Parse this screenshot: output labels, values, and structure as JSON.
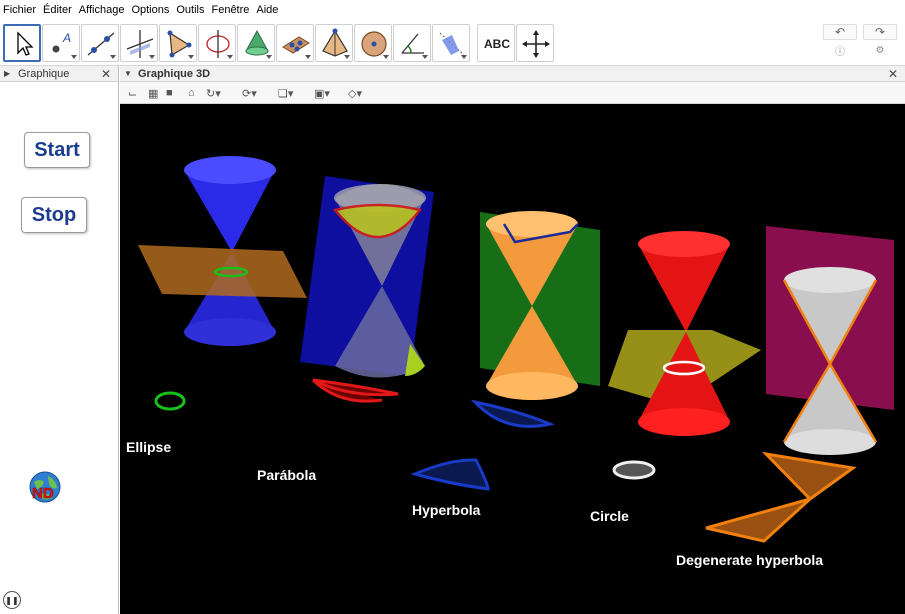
{
  "menu": [
    "Fichier",
    "Éditer",
    "Affichage",
    "Options",
    "Outils",
    "Fenêtre",
    "Aide"
  ],
  "toolbar": {
    "tools": [
      {
        "icon": "move-arrow-icon"
      },
      {
        "icon": "point-icon"
      },
      {
        "icon": "line-icon"
      },
      {
        "icon": "perpendicular-line-icon"
      },
      {
        "icon": "polygon-icon"
      },
      {
        "icon": "intersect-icon"
      },
      {
        "icon": "cone-surface-icon"
      },
      {
        "icon": "plane-icon"
      },
      {
        "icon": "pyramid-icon"
      },
      {
        "icon": "sphere-icon"
      },
      {
        "icon": "angle-icon"
      },
      {
        "icon": "reflect-icon"
      },
      {
        "icon": "text-tool-icon",
        "label": "ABC"
      },
      {
        "icon": "move-view-icon"
      }
    ],
    "undo_icon": "undo-icon",
    "redo_icon": "redo-icon",
    "help_icon": "help-icon",
    "settings_icon": "settings-icon"
  },
  "left_panel": {
    "title": "Graphique",
    "start_label": "Start",
    "stop_label": "Stop",
    "logo_text": "ND"
  },
  "view3d": {
    "title": "Graphique 3D",
    "labels": {
      "ellipse": "Ellipse",
      "parabola": "Parábola",
      "hyperbola": "Hyperbola",
      "circle": "Circle",
      "degenerate": "Degenerate hyperbola"
    }
  },
  "colors": {
    "ellipse_cone": "#2a2ae8",
    "parabola_plane": "#1010b0",
    "hyperbola_cone": "#f29a3c",
    "hyperbola_plane": "#1a7a1a",
    "circle_cone": "#e51414",
    "circle_plane": "#c8c020",
    "degenerate_cone": "#c8c8c8",
    "degenerate_plane": "#a0105a",
    "selected_tool": "#3d6bb3",
    "button_text": "#1a3d8f"
  }
}
